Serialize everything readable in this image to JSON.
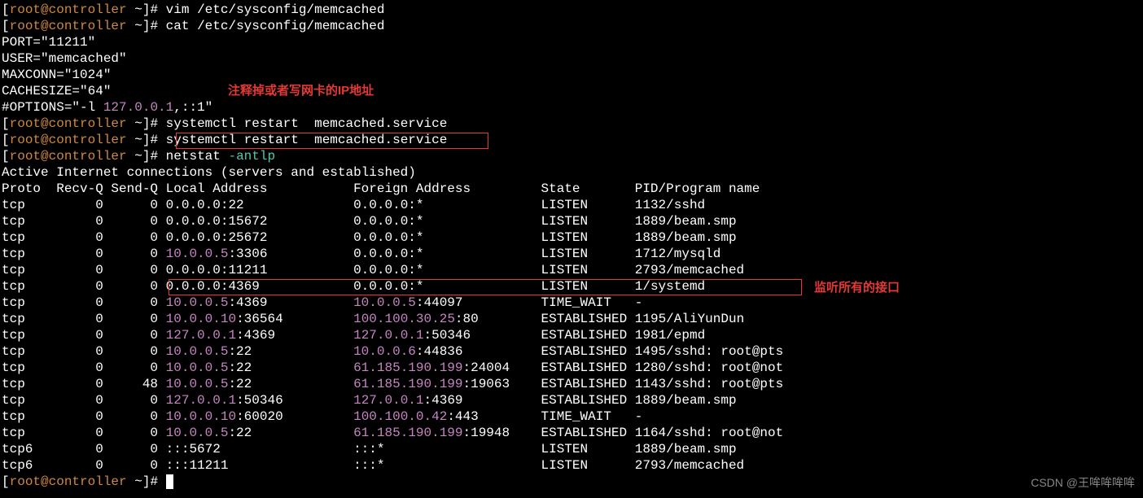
{
  "prompts": [
    {
      "prefix": "[",
      "user": "root@controller",
      "path": " ~",
      "suffix": "]# ",
      "cmd": "vim /etc/sysconfig/memcached"
    },
    {
      "prefix": "[",
      "user": "root@controller",
      "path": " ~",
      "suffix": "]# ",
      "cmd": "cat /etc/sysconfig/memcached"
    }
  ],
  "config_lines": [
    "PORT=\"11211\"",
    "USER=\"memcached\"",
    "MAXCONN=\"1024\"",
    "CACHESIZE=\"64\""
  ],
  "options_line": {
    "pre": "#OPTIONS=\"-l ",
    "ip": "127.0.0.1",
    "post": ",::1\""
  },
  "annotation1": "注释掉或者写网卡的IP地址",
  "annotation2": "监听所有的接口",
  "prompts2": [
    {
      "prefix": "[",
      "user": "root@controller",
      "path": " ~",
      "suffix": "]# ",
      "cmd": "systemctl restart  memcached.service"
    },
    {
      "prefix": "[",
      "user": "root@controller",
      "path": " ~",
      "suffix": "]# ",
      "cmd": "systemctl restart  memcached.service"
    },
    {
      "prefix": "[",
      "user": "root@controller",
      "path": " ~",
      "suffix": "]# ",
      "cmd_pre": "netstat ",
      "cmd_opt": "-antlp"
    }
  ],
  "netstat_header1": "Active Internet connections (servers and established)",
  "netstat_cols": {
    "proto": "Proto",
    "recvq": "Recv-Q",
    "sendq": "Send-Q",
    "local": "Local Address",
    "foreign": "Foreign Address",
    "state": "State",
    "pid": "PID/Program name"
  },
  "rows": [
    {
      "proto": "tcp",
      "recvq": "0",
      "sendq": "0",
      "la_ip": "",
      "la": "0.0.0.0:22",
      "fa_ip": "",
      "fa": "0.0.0.0:*",
      "state": "LISTEN",
      "pid": "1132/sshd"
    },
    {
      "proto": "tcp",
      "recvq": "0",
      "sendq": "0",
      "la_ip": "",
      "la": "0.0.0.0:15672",
      "fa_ip": "",
      "fa": "0.0.0.0:*",
      "state": "LISTEN",
      "pid": "1889/beam.smp"
    },
    {
      "proto": "tcp",
      "recvq": "0",
      "sendq": "0",
      "la_ip": "",
      "la": "0.0.0.0:25672",
      "fa_ip": "",
      "fa": "0.0.0.0:*",
      "state": "LISTEN",
      "pid": "1889/beam.smp"
    },
    {
      "proto": "tcp",
      "recvq": "0",
      "sendq": "0",
      "la_ip": "10.0.0.5",
      "la": ":3306",
      "fa_ip": "",
      "fa": "0.0.0.0:*",
      "state": "LISTEN",
      "pid": "1712/mysqld"
    },
    {
      "proto": "tcp",
      "recvq": "0",
      "sendq": "0",
      "la_ip": "",
      "la": "0.0.0.0:11211",
      "fa_ip": "",
      "fa": "0.0.0.0:*",
      "state": "LISTEN",
      "pid": "2793/memcached"
    },
    {
      "proto": "tcp",
      "recvq": "0",
      "sendq": "0",
      "la_ip": "",
      "la": "0.0.0.0:4369",
      "fa_ip": "",
      "fa": "0.0.0.0:*",
      "state": "LISTEN",
      "pid": "1/systemd"
    },
    {
      "proto": "tcp",
      "recvq": "0",
      "sendq": "0",
      "la_ip": "10.0.0.5",
      "la": ":4369",
      "fa_ip": "10.0.0.5",
      "fa": ":44097",
      "state": "TIME_WAIT",
      "pid": "-"
    },
    {
      "proto": "tcp",
      "recvq": "0",
      "sendq": "0",
      "la_ip": "10.0.0.10",
      "la": ":36564",
      "fa_ip": "100.100.30.25",
      "fa": ":80",
      "state": "ESTABLISHED",
      "pid": "1195/AliYunDun"
    },
    {
      "proto": "tcp",
      "recvq": "0",
      "sendq": "0",
      "la_ip": "127.0.0.1",
      "la": ":4369",
      "fa_ip": "127.0.0.1",
      "fa": ":50346",
      "state": "ESTABLISHED",
      "pid": "1981/epmd"
    },
    {
      "proto": "tcp",
      "recvq": "0",
      "sendq": "0",
      "la_ip": "10.0.0.5",
      "la": ":22",
      "fa_ip": "10.0.0.6",
      "fa": ":44836",
      "state": "ESTABLISHED",
      "pid": "1495/sshd: root@pts"
    },
    {
      "proto": "tcp",
      "recvq": "0",
      "sendq": "0",
      "la_ip": "10.0.0.5",
      "la": ":22",
      "fa_ip": "61.185.190.199",
      "fa": ":24004",
      "state": "ESTABLISHED",
      "pid": "1280/sshd: root@not"
    },
    {
      "proto": "tcp",
      "recvq": "0",
      "sendq": "48",
      "la_ip": "10.0.0.5",
      "la": ":22",
      "fa_ip": "61.185.190.199",
      "fa": ":19063",
      "state": "ESTABLISHED",
      "pid": "1143/sshd: root@pts"
    },
    {
      "proto": "tcp",
      "recvq": "0",
      "sendq": "0",
      "la_ip": "127.0.0.1",
      "la": ":50346",
      "fa_ip": "127.0.0.1",
      "fa": ":4369",
      "state": "ESTABLISHED",
      "pid": "1889/beam.smp"
    },
    {
      "proto": "tcp",
      "recvq": "0",
      "sendq": "0",
      "la_ip": "10.0.0.10",
      "la": ":60020",
      "fa_ip": "100.100.0.42",
      "fa": ":443",
      "state": "TIME_WAIT",
      "pid": "-"
    },
    {
      "proto": "tcp",
      "recvq": "0",
      "sendq": "0",
      "la_ip": "10.0.0.5",
      "la": ":22",
      "fa_ip": "61.185.190.199",
      "fa": ":19948",
      "state": "ESTABLISHED",
      "pid": "1164/sshd: root@not"
    },
    {
      "proto": "tcp6",
      "recvq": "0",
      "sendq": "0",
      "la_ip": "",
      "la": ":::5672",
      "fa_ip": "",
      "fa": ":::*",
      "state": "LISTEN",
      "pid": "1889/beam.smp"
    },
    {
      "proto": "tcp6",
      "recvq": "0",
      "sendq": "0",
      "la_ip": "",
      "la": ":::11211",
      "fa_ip": "",
      "fa": ":::*",
      "state": "LISTEN",
      "pid": "2793/memcached"
    }
  ],
  "final_prompt": {
    "prefix": "[",
    "user": "root@controller",
    "path": " ~",
    "suffix": "]# "
  },
  "watermark": "CSDN @王哞哞哞哞"
}
